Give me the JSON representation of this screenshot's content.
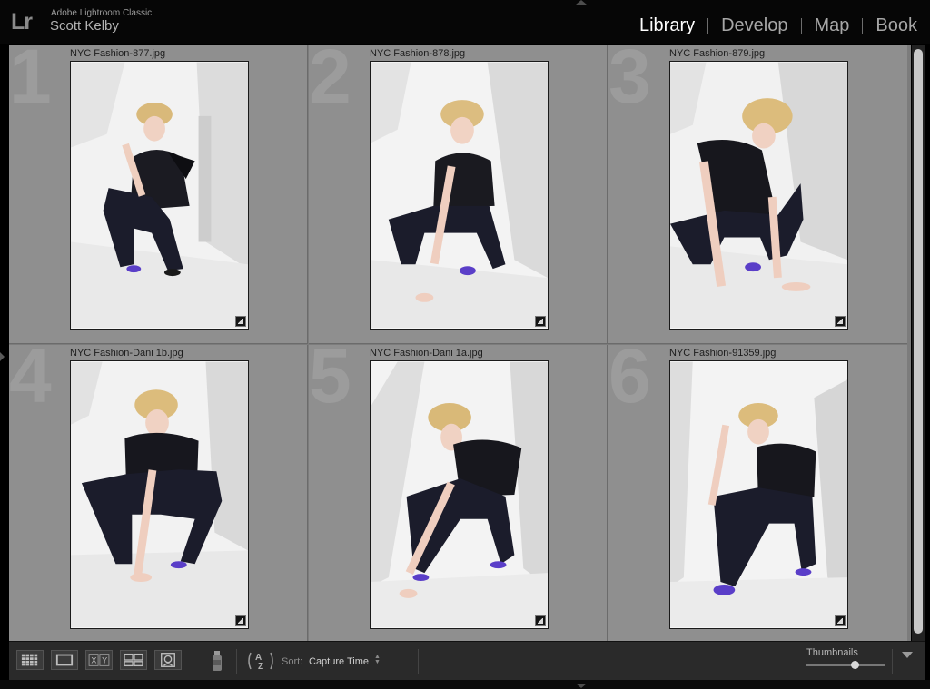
{
  "app": {
    "logo": "Lr",
    "name": "Adobe Lightroom Classic",
    "user": "Scott Kelby"
  },
  "modules": [
    {
      "label": "Library",
      "active": true
    },
    {
      "label": "Develop",
      "active": false
    },
    {
      "label": "Map",
      "active": false
    },
    {
      "label": "Book",
      "active": false
    }
  ],
  "grid": {
    "cells": [
      {
        "index": "1",
        "filename": "NYC Fashion-877.jpg"
      },
      {
        "index": "2",
        "filename": "NYC Fashion-878.jpg"
      },
      {
        "index": "3",
        "filename": "NYC Fashion-879.jpg"
      },
      {
        "index": "4",
        "filename": "NYC Fashion-Dani 1b.jpg"
      },
      {
        "index": "5",
        "filename": "NYC Fashion-Dani 1a.jpg"
      },
      {
        "index": "6",
        "filename": "NYC Fashion-91359.jpg"
      }
    ]
  },
  "toolbar": {
    "view_buttons": [
      {
        "icon": "grid-view-icon"
      },
      {
        "icon": "loupe-view-icon"
      },
      {
        "icon": "compare-view-icon",
        "text": "XY"
      },
      {
        "icon": "survey-view-icon"
      },
      {
        "icon": "people-view-icon"
      }
    ],
    "painter_icon": "spray-can-icon",
    "sort_direction_icon": "sort-az-icon",
    "sort_label": "Sort:",
    "sort_value": "Capture Time",
    "thumbnails_label": "Thumbnails",
    "thumbnail_size": 0.62
  },
  "colors": {
    "module_active": "#ffffff",
    "module_inactive": "#a6a6a6",
    "grid_cell": "#8f8f8f"
  }
}
